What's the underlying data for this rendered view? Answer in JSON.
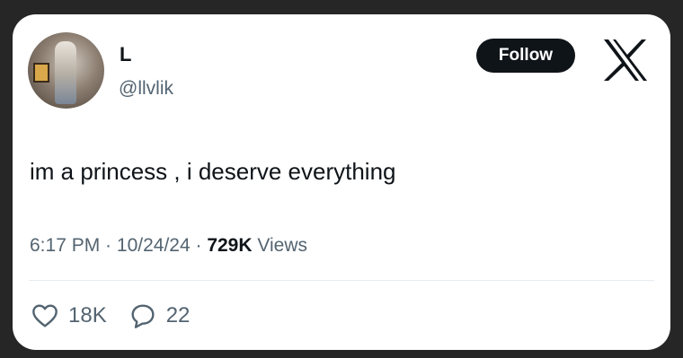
{
  "user": {
    "display_name": "L",
    "handle": "@llvlik"
  },
  "follow_label": "Follow",
  "tweet": {
    "text": "im a princess , i deserve everything",
    "time": "6:17 PM",
    "date": "10/24/24",
    "views_count": "729K",
    "views_label": "Views",
    "separator": " · "
  },
  "actions": {
    "likes": "18K",
    "replies": "22"
  },
  "icons": {
    "logo": "x-logo-icon",
    "like": "heart-icon",
    "reply": "speech-bubble-icon"
  },
  "colors": {
    "background": "#262626",
    "card": "#ffffff",
    "text": "#0f1419",
    "muted": "#536471"
  }
}
